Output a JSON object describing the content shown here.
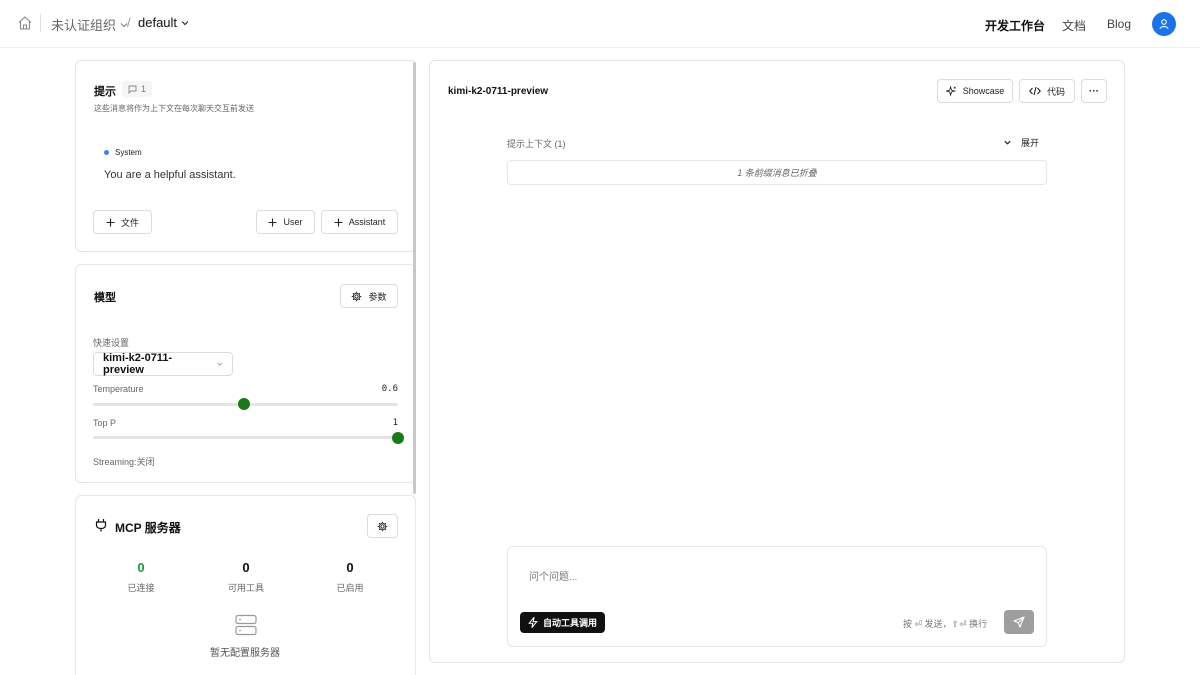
{
  "header": {
    "org_label": "未认证组织",
    "separator": "/",
    "project_label": "default",
    "nav_workbench": "开发工作台",
    "nav_docs": "文档",
    "nav_blog": "Blog"
  },
  "prompt_card": {
    "title": "提示",
    "message_count": "1",
    "subtitle": "这些消息将作为上下文在每次聊天交互前发送",
    "system_role": "System",
    "system_text": "You are a helpful assistant.",
    "file_button": "文件",
    "user_button": "User",
    "assistant_button": "Assistant"
  },
  "model_card": {
    "title": "模型",
    "params_button": "参数",
    "quick_settings_label": "快速设置",
    "selected_model": "kimi-k2-0711-preview",
    "temperature_label": "Temperature",
    "temperature_value": "0.6",
    "temperature_fraction": 0.6,
    "top_p_label": "Top P",
    "top_p_value": "1",
    "top_p_fraction": 1.0,
    "streaming_label": "Streaming:关闭"
  },
  "mcp_card": {
    "title": "MCP 服务器",
    "stats": [
      {
        "value": "0",
        "label": "已连接",
        "color": "#1a9a3a"
      },
      {
        "value": "0",
        "label": "可用工具",
        "color": "#111111"
      },
      {
        "value": "0",
        "label": "已启用",
        "color": "#111111"
      }
    ],
    "empty_text": "暂无配置服务器"
  },
  "main_panel": {
    "model_title": "kimi-k2-0711-preview",
    "showcase_button": "Showcase",
    "code_button": "代码",
    "more_button": "···",
    "context_label": "提示上下文 (1)",
    "expand_label": "展开",
    "collapsed_text": "1 条前缀消息已折叠",
    "input_placeholder": "问个问题...",
    "auto_tool_label": "自动工具调用",
    "send_hint": "按 ⏎ 发送，⇧⏎ 换行"
  },
  "colors": {
    "accent_blue": "#1a73e8",
    "slider_green": "#1a7a1a",
    "connected_green": "#1a9a3a",
    "system_dot": "#3b82f6"
  }
}
